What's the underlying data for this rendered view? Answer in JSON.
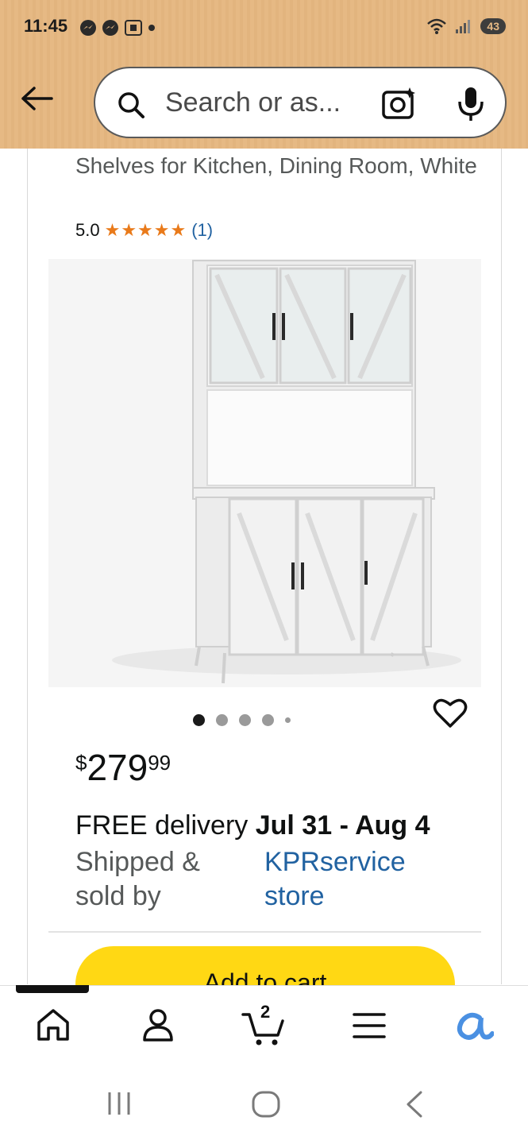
{
  "status_bar": {
    "time": "11:45",
    "battery": "43"
  },
  "search": {
    "placeholder": "Search or as..."
  },
  "product": {
    "title": "Shelves for Kitchen, Dining Room, White",
    "rating": "5.0",
    "stars": "★★★★★",
    "review_count": "(1)",
    "image_count": 5,
    "active_image_index": 0,
    "price": {
      "currency": "$",
      "whole": "279",
      "fraction": "99"
    },
    "delivery_prefix": "FREE delivery ",
    "delivery_dates": "Jul 31 - Aug 4",
    "shipped_label": "Shipped & sold by",
    "seller": "KPRservice store",
    "add_to_cart_label": "Add to cart"
  },
  "bottom_nav": {
    "items": [
      "home",
      "account",
      "cart",
      "menu",
      "rufus"
    ],
    "cart_count": "2"
  },
  "colors": {
    "header": "#e6b984",
    "star": "#e97a1a",
    "link": "#2162a1",
    "add_to_cart": "#ffd814",
    "rufus": "#4a90e2"
  }
}
